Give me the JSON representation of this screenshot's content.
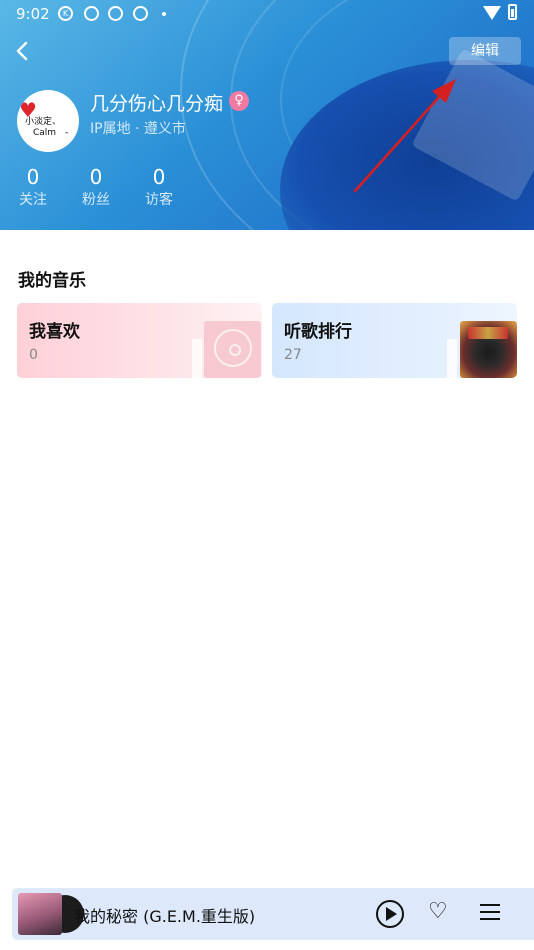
{
  "status_bar": {
    "time": "9:02",
    "icons": [
      "k-icon",
      "aperture-icon",
      "aperture-icon",
      "aperture-icon",
      "dot-icon",
      "wifi-icon",
      "battery-icon"
    ],
    "k_label": "K"
  },
  "header": {
    "edit_label": "编辑",
    "username": "几分伤心几分痴",
    "gender_icon": "♀",
    "ip_location": "IP属地 · 遵义市",
    "avatar_text": {
      "line1": "小淡定、",
      "line2": "Calm",
      "line3": "-"
    },
    "stats": [
      {
        "value": "0",
        "label": "关注"
      },
      {
        "value": "0",
        "label": "粉丝"
      },
      {
        "value": "0",
        "label": "访客"
      }
    ]
  },
  "my_music": {
    "title": "我的音乐",
    "cards": [
      {
        "title": "我喜欢",
        "count": "0"
      },
      {
        "title": "听歌排行",
        "count": "27"
      }
    ]
  },
  "player": {
    "song": "我的秘密 (G.E.M.重生版)",
    "heart_icon": "♡"
  },
  "colors": {
    "header_start": "#5ab8e6",
    "header_end": "#1c64c4",
    "annotation_arrow": "#d42020",
    "like_card": "#ffd0d8",
    "rank_card": "#d4e7fd",
    "player_bg": "#dde9fb",
    "gender_badge": "#f07aa2"
  }
}
